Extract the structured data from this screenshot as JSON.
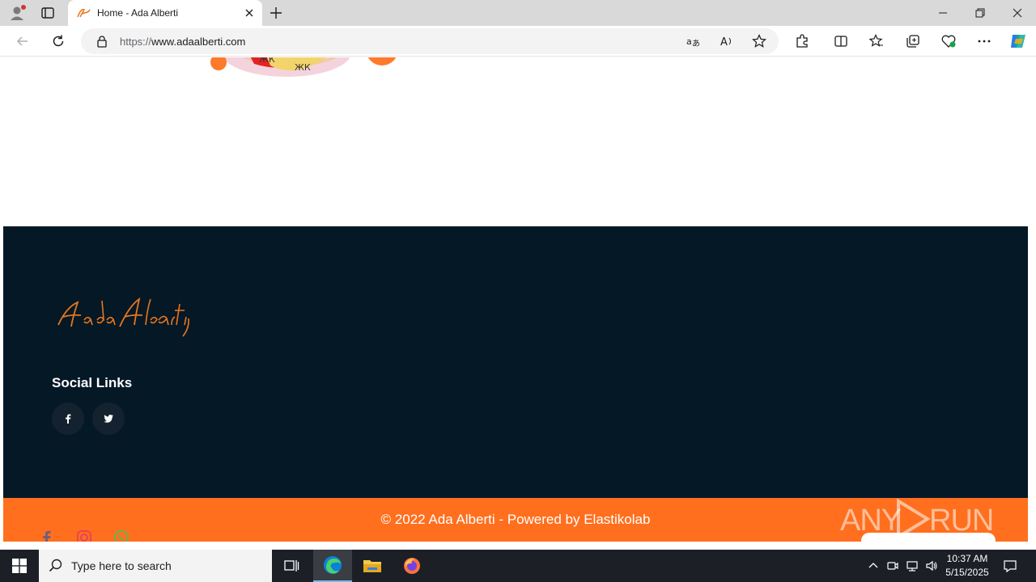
{
  "browser": {
    "tab_title": "Home - Ada Alberti",
    "url_prefix": "https://",
    "url_domain": "www.adaalberti.com"
  },
  "icons": {
    "profile": "profile-icon",
    "tab_actions": "tab-actions-icon",
    "close": "close-icon",
    "new_tab": "plus-icon",
    "back": "arrow-left-icon",
    "refresh": "refresh-icon",
    "lock": "lock-icon",
    "translate": "translate-icon",
    "read_aloud": "read-aloud-icon",
    "favorite": "star-icon",
    "extensions": "puzzle-icon",
    "split": "split-screen-icon",
    "favorites_bar": "favorites-icon",
    "collections": "collections-icon",
    "browser_essentials": "heart-pulse-icon",
    "more": "more-icon",
    "copilot": "copilot-icon"
  },
  "footer": {
    "logo_text": "Ada Alberti",
    "social_heading": "Social Links",
    "social": [
      "facebook",
      "twitter"
    ],
    "copyright": "© 2022 Ada Alberti - Powered by Elastikolab",
    "watermark": "ANY RUN"
  },
  "taskbar": {
    "search_placeholder": "Type here to search",
    "time": "10:37 AM",
    "date": "5/15/2025"
  },
  "colors": {
    "footer_bg": "#051826",
    "accent": "#ff6f1e",
    "signature": "#e8761e"
  }
}
